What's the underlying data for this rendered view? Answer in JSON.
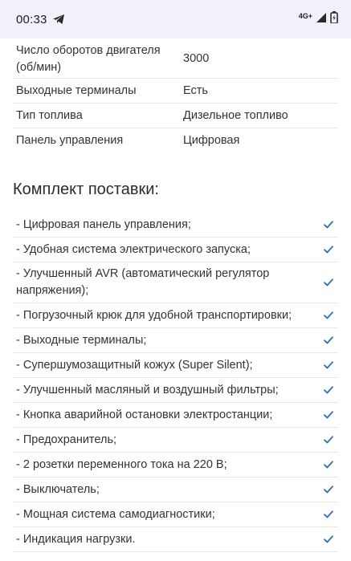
{
  "status_bar": {
    "time": "00:33",
    "network": "4G+",
    "icons": [
      "telegram-icon",
      "signal-icon",
      "battery-icon"
    ]
  },
  "specs": [
    {
      "label": "Число оборотов двигателя (об/мин)",
      "value": "3000"
    },
    {
      "label": "Выходные терминалы",
      "value": "Есть"
    },
    {
      "label": "Тип топлива",
      "value": "Дизельное топливо"
    },
    {
      "label": "Панель управления",
      "value": "Цифровая"
    }
  ],
  "kit": {
    "title": "Комплект поставки:",
    "items": [
      "- Цифровая панель управления;",
      "- Удобная система электрического запуска;",
      "- Улучшенный AVR (автоматический регулятор напряжения);",
      "- Погрузочный крюк для удобной транспортировки;",
      "- Выходные терминалы;",
      "- Супершумозащитный кожух (Super Silent);",
      "- Улучшенный масляный и воздушный фильтры;",
      "- Кнопка аварийной остановки электростанции;",
      "- Предохранитель;",
      "- 2 розетки переменного тока на 220 В;",
      "- Выключатель;",
      "- Мощная система самодиагностики;",
      "- Индикация нагрузки."
    ],
    "check_color": "#2f6db5"
  }
}
